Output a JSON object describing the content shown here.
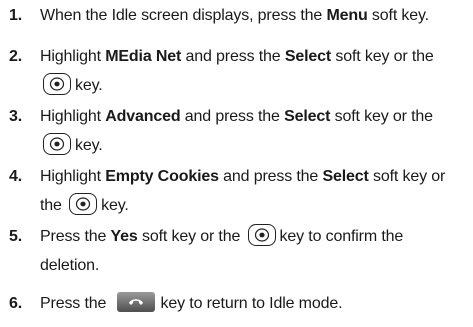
{
  "steps": [
    {
      "number": "1.",
      "p1": "When the Idle screen displays, press the ",
      "b1": "Menu",
      "p2": " soft key."
    },
    {
      "number": "2.",
      "p1": "Highlight ",
      "b1": "MEdia Net",
      "p2": " and press the ",
      "b2": "Select",
      "p3": " soft key or the",
      "p4": "key."
    },
    {
      "number": "3.",
      "p1": "Highlight ",
      "b1": "Advanced",
      "p2": " and press the ",
      "b2": "Select",
      "p3": " soft key or the",
      "p4": "key."
    },
    {
      "number": "4.",
      "p1": "Highlight ",
      "b1": "Empty Cookies",
      "p2": " and press the ",
      "b2": "Select",
      "p3": " soft key or",
      "p4": "the ",
      "p5": "key."
    },
    {
      "number": "5.",
      "p1": "Press the ",
      "b1": "Yes",
      "p2": " soft key or the ",
      "p3": "key to confirm the",
      "p4": "deletion."
    },
    {
      "number": "6.",
      "p1": "Press the ",
      "p2": "key to return to Idle mode."
    }
  ],
  "icons": {
    "select_key": "center-select-key-icon",
    "end_key": "end-call-key-icon"
  }
}
